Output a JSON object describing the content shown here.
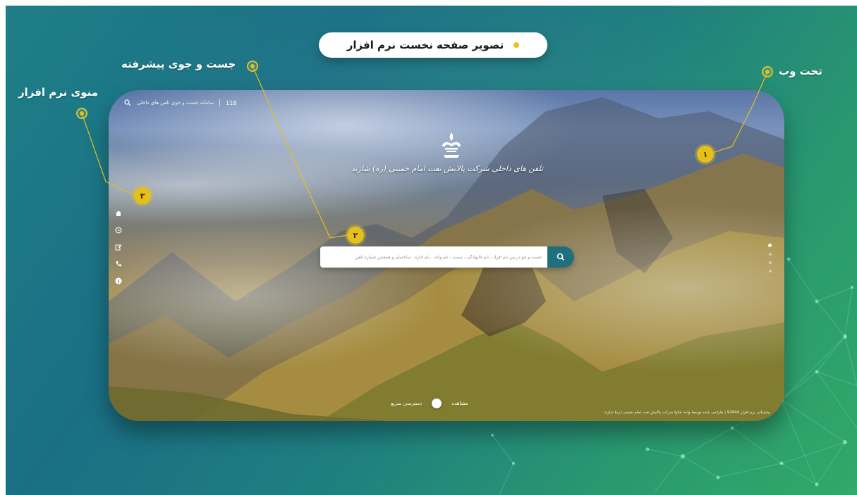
{
  "title": "تصویر صفحه نخست نرم افزار",
  "callouts": {
    "web": "تحت وب",
    "search": "جست و جوی پیشرفته",
    "menu": "منوی نرم افزار"
  },
  "badges": [
    "۱",
    "۲",
    "۳"
  ],
  "mockup": {
    "topbar": {
      "number": "118",
      "link_text": "سامانه جست و جوی تلفن های داخلی",
      "search_icon": "search-icon"
    },
    "logo_icon": "oil-company-logo",
    "company_name": "تلفن های داخلی شرکت پالایش نفت امام خمینی (ره) شازند",
    "sidebar_icons": [
      "home-icon",
      "history-icon",
      "edit-icon",
      "phone-icon",
      "info-icon"
    ],
    "search": {
      "placeholder": "جست و جو در بین نام افراد ، نام خانوادگی ، سمت ، نام واحد ، نام اداره ، ساختمان و همچنین شماره تلفن",
      "button_icon": "search-icon"
    },
    "slider_dots": 4,
    "quick_access": {
      "view": "مشاهده",
      "label": "دسترسی سریع"
    },
    "footer": "پشتیبانی نرم افزار 92944 | طراحی شده توسط واحد فناوا شرکت پالایش نفت امام خمینی (ره) شازند"
  },
  "colors": {
    "accent": "#e5c01b",
    "search_button": "#1f6f7d",
    "background_start": "#1e7f87",
    "background_end": "#33a868"
  }
}
